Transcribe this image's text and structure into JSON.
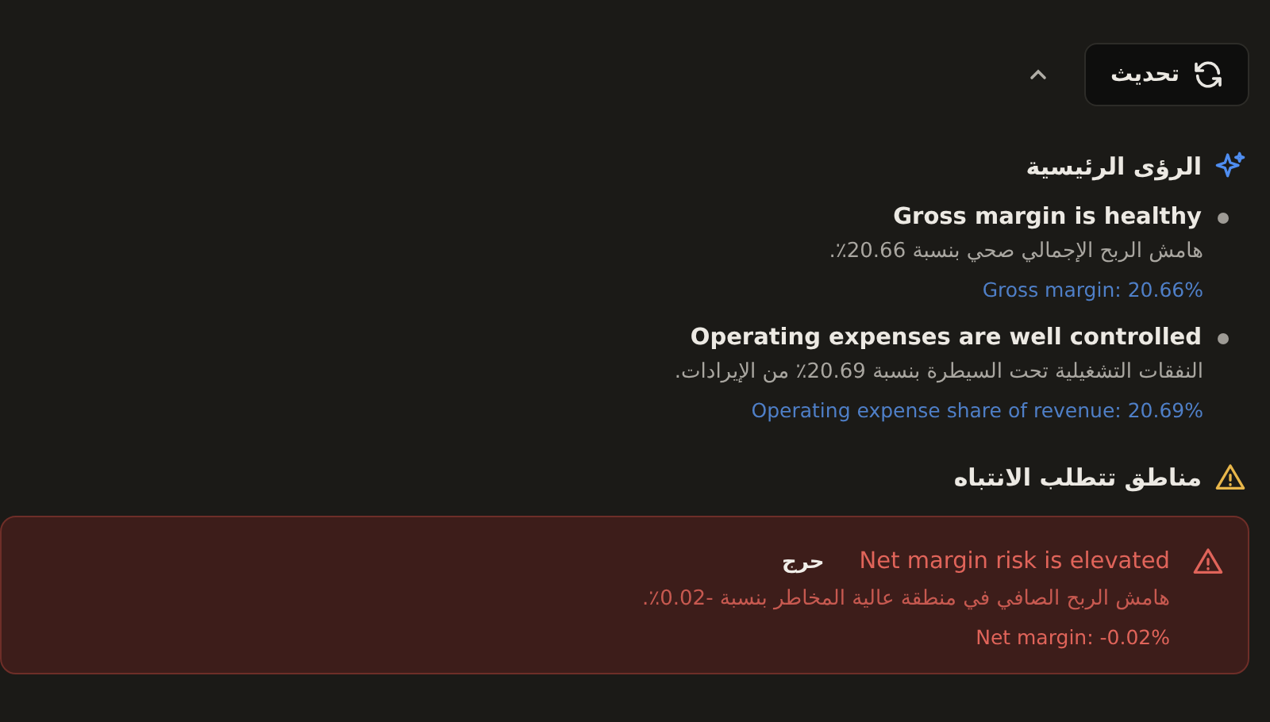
{
  "toolbar": {
    "refresh_button": "تحديث",
    "collapse": {
      "expanded": true
    }
  },
  "insights": {
    "title": "الرؤى الرئيسية",
    "items": [
      {
        "title": "Gross margin is healthy",
        "description": "هامش الربح الإجمالي صحي بنسبة 20.66٪.",
        "metric": "Gross margin: 20.66%"
      },
      {
        "title": "Operating expenses are well controlled",
        "description": "النفقات التشغيلية تحت السيطرة بنسبة 20.69٪ من الإيرادات.",
        "metric": "Operating expense share of revenue: 20.69%"
      }
    ]
  },
  "attention": {
    "title": "مناطق تتطلب الانتباه",
    "items": [
      {
        "kind": "critical",
        "title": "Net margin risk is elevated",
        "badge": "حرج",
        "description": "هامش الربح الصافي في منطقة عالية المخاطر بنسبة -0.02٪.",
        "metric": "Net margin: -0.02%"
      }
    ]
  }
}
